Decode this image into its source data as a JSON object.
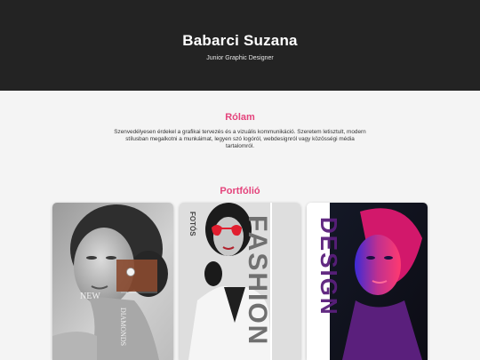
{
  "header": {
    "name": "Babarci Suzana",
    "role": "Junior Graphic Designer"
  },
  "about": {
    "title": "Rólam",
    "text": "Szenvedélyesen érdekel a grafikai tervezés és a vizuális kommunikáció. Szeretem letisztult, modern stílusban megalkotni a munkáimat, legyen szó logóról, webdesignról vagy közösségi média tartalomról."
  },
  "portfolio": {
    "title": "Portfólió",
    "items": [
      {
        "label_new": "NEW",
        "label_side": "DIAMONDS"
      },
      {
        "label_big": "FASHION",
        "label_small": "FOTÓS"
      },
      {
        "label_big": "DESIGN"
      }
    ]
  },
  "colors": {
    "accent": "#e4447c",
    "header_bg": "#232323",
    "page_bg": "#f4f4f4"
  }
}
